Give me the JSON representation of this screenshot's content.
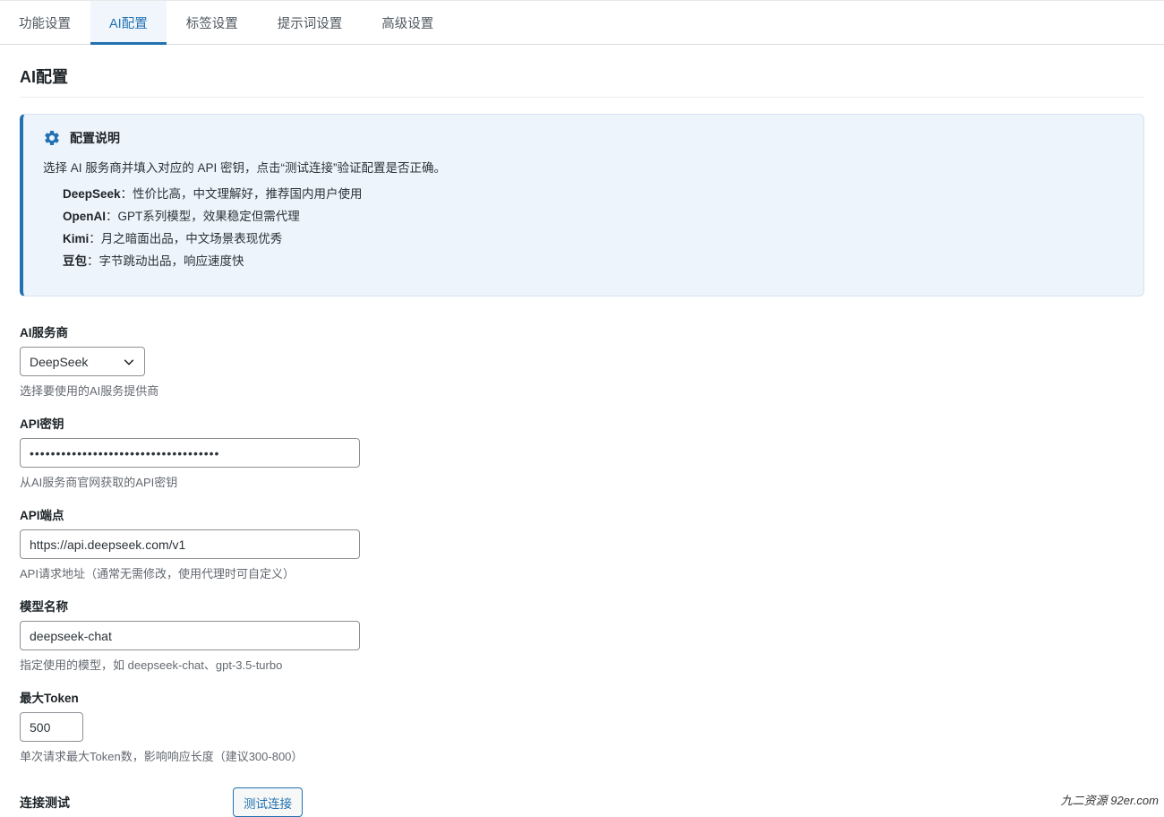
{
  "tabs": [
    {
      "label": "功能设置",
      "active": false
    },
    {
      "label": "AI配置",
      "active": true
    },
    {
      "label": "标签设置",
      "active": false
    },
    {
      "label": "提示词设置",
      "active": false
    },
    {
      "label": "高级设置",
      "active": false
    }
  ],
  "page_title": "AI配置",
  "notice": {
    "icon": "gear-icon",
    "title": "配置说明",
    "description": "选择 AI 服务商并填入对应的 API 密钥，点击“测试连接”验证配置是否正确。",
    "items": [
      {
        "name": "DeepSeek",
        "text": "：性价比高，中文理解好，推荐国内用户使用"
      },
      {
        "name": "OpenAI",
        "text": "：GPT系列模型，效果稳定但需代理"
      },
      {
        "name": "Kimi",
        "text": "：月之暗面出品，中文场景表现优秀"
      },
      {
        "name": "豆包",
        "text": "：字节跳动出品，响应速度快"
      }
    ]
  },
  "form": {
    "provider": {
      "label": "AI服务商",
      "value": "DeepSeek",
      "description": "选择要使用的AI服务提供商"
    },
    "api_key": {
      "label": "API密钥",
      "value": "••••••••••••••••••••••••••••••••••••",
      "description": "从AI服务商官网获取的API密钥"
    },
    "endpoint": {
      "label": "API端点",
      "value": "https://api.deepseek.com/v1",
      "description": "API请求地址（通常无需修改，使用代理时可自定义）"
    },
    "model": {
      "label": "模型名称",
      "value": "deepseek-chat",
      "description": "指定使用的模型，如 deepseek-chat、gpt-3.5-turbo"
    },
    "max_token": {
      "label": "最大Token",
      "value": "500",
      "description": "单次请求最大Token数，影响响应长度（建议300-800）"
    },
    "connection": {
      "label": "连接测试",
      "button": "测试连接"
    }
  },
  "watermark": "九二资源  92er.com",
  "colors": {
    "accent": "#2271b1",
    "notice_bg": "#edf4fc"
  }
}
